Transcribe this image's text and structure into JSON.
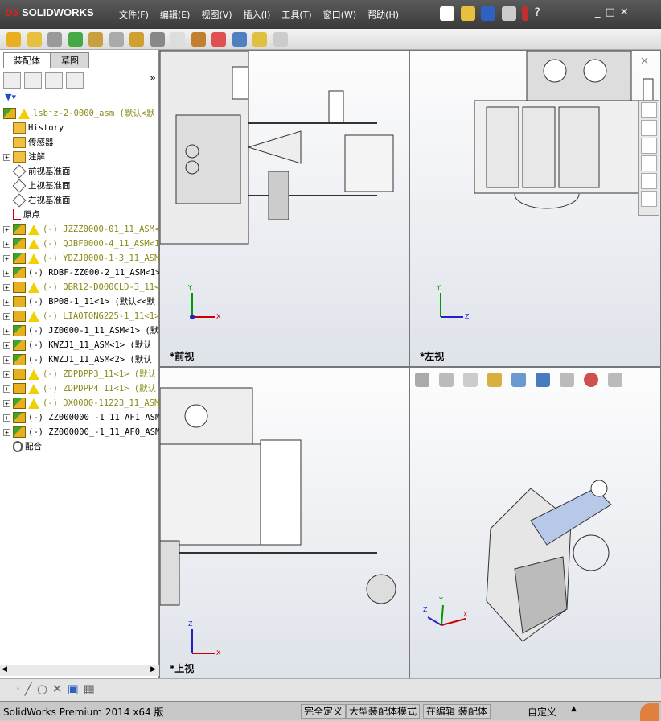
{
  "app": {
    "brand": "SOLIDWORKS",
    "brand_prefix": "DS"
  },
  "menu": [
    "文件(F)",
    "编辑(E)",
    "视图(V)",
    "插入(I)",
    "工具(T)",
    "窗口(W)",
    "帮助(H)"
  ],
  "panel_tabs": [
    "装配体",
    "草图"
  ],
  "tree": [
    {
      "label": "lsbjz-2-0000_asm  (默认<默",
      "type": "root",
      "warn": true
    },
    {
      "label": "History",
      "type": "history"
    },
    {
      "label": "传感器",
      "type": "sensor"
    },
    {
      "label": "注解",
      "type": "annot",
      "expand": true
    },
    {
      "label": "前视基准面",
      "type": "plane"
    },
    {
      "label": "上视基准面",
      "type": "plane"
    },
    {
      "label": "右视基准面",
      "type": "plane"
    },
    {
      "label": "原点",
      "type": "origin"
    },
    {
      "label": "(-) JZZZ0000-01_11_ASM<",
      "type": "asm",
      "warn": true,
      "expand": true
    },
    {
      "label": "(-) QJBF0000-4_11_ASM<1",
      "type": "asm",
      "warn": true,
      "expand": true
    },
    {
      "label": "(-) YDZJ0000-1-3_11_ASM",
      "type": "asm",
      "warn": true,
      "expand": true
    },
    {
      "label": "(-) RDBF-ZZ000-2_11_ASM<1>",
      "type": "asm",
      "expand": true
    },
    {
      "label": "(-) QBR12-D000CLD-3_11<",
      "type": "prt",
      "warn": true,
      "expand": true
    },
    {
      "label": "(-) BP08-1_11<1> (默认<<默",
      "type": "prt",
      "expand": true
    },
    {
      "label": "(-) LIAOTONG225-1_11<1>",
      "type": "prt",
      "warn": true,
      "expand": true
    },
    {
      "label": "(-) JZ0000-1_11_ASM<1> (默",
      "type": "asm",
      "expand": true
    },
    {
      "label": "(-) KWZJ1_11_ASM<1> (默认",
      "type": "asm",
      "expand": true
    },
    {
      "label": "(-) KWZJ1_11_ASM<2> (默认",
      "type": "asm",
      "expand": true
    },
    {
      "label": "(-) ZDPDPP3_11<1> (默认",
      "type": "prt",
      "warn": true,
      "expand": true
    },
    {
      "label": "(-) ZDPDPP4_11<1> (默认",
      "type": "prt",
      "warn": true,
      "expand": true
    },
    {
      "label": "(-) DX0000-11223_11_ASM",
      "type": "asm",
      "warn": true,
      "expand": true
    },
    {
      "label": "(-) ZZ000000_-1_11_AF1_ASM",
      "type": "asm",
      "expand": true
    },
    {
      "label": "(-) ZZ000000_-1_11_AF0_ASM",
      "type": "asm",
      "expand": true
    },
    {
      "label": "配合",
      "type": "mates"
    }
  ],
  "viewports": {
    "front": "*前视",
    "left": "*左视",
    "top": "*上视"
  },
  "axes": {
    "x": "X",
    "y": "Y",
    "z": "Z"
  },
  "status": {
    "product": "SolidWorks Premium 2014 x64 版",
    "s1": "完全定义",
    "s2": "大型装配体模式",
    "s3": "在编辑 装配体",
    "s4": "自定义",
    "s5": "▲"
  },
  "colors": {
    "accent": "#e02020",
    "warn_text": "#8a8a1a"
  }
}
